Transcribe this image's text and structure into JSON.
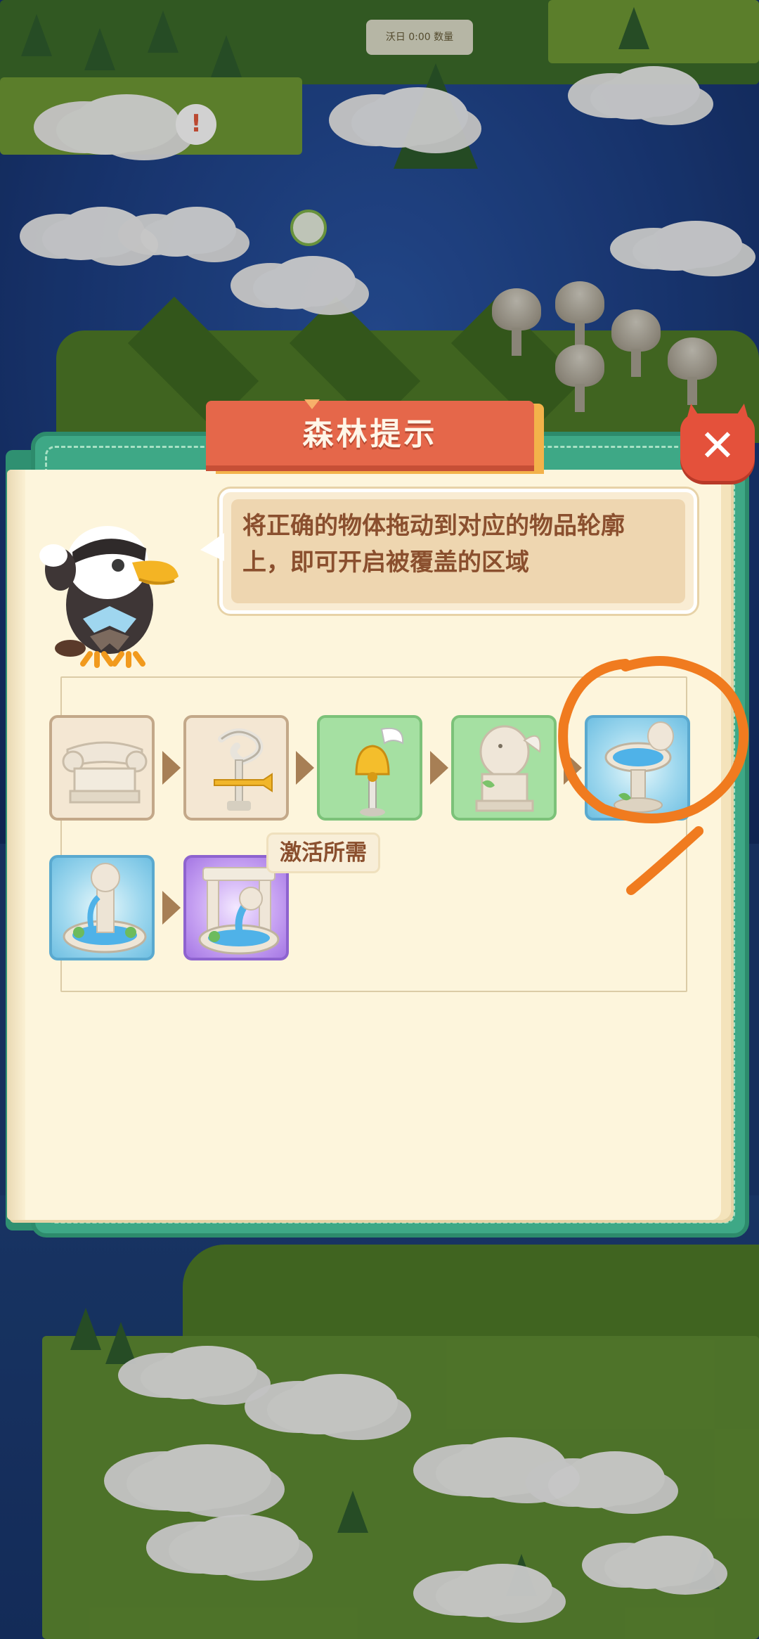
{
  "hud": {
    "status_chip": "沃日 0:00 数量"
  },
  "alert": {
    "glyph": "!"
  },
  "dialog": {
    "title": "森林提示",
    "close_glyph": "✕",
    "hint_text": "将正确的物体拖动到对应的物品轮廓上，即可开启被覆盖的区域",
    "requirement_label": "激活所需",
    "chain": [
      {
        "icon": "stone-pillar-capital-icon",
        "tier": "beige"
      },
      {
        "icon": "weathervane-icon",
        "tier": "beige"
      },
      {
        "icon": "golden-bell-staff-icon",
        "tier": "green"
      },
      {
        "icon": "bird-statue-pedestal-icon",
        "tier": "green"
      },
      {
        "icon": "bird-birdbath-icon",
        "tier": "blue"
      },
      {
        "icon": "bird-fountain-icon",
        "tier": "blue"
      },
      {
        "icon": "arch-fountain-icon",
        "tier": "purple"
      }
    ]
  },
  "colors": {
    "panel_green": "#3ea886",
    "title_red": "#e5674a",
    "close_red": "#e4513b",
    "paper": "#fdf5dc",
    "hint_text": "#8a4f2e",
    "annotation_orange": "#f07b1f"
  }
}
